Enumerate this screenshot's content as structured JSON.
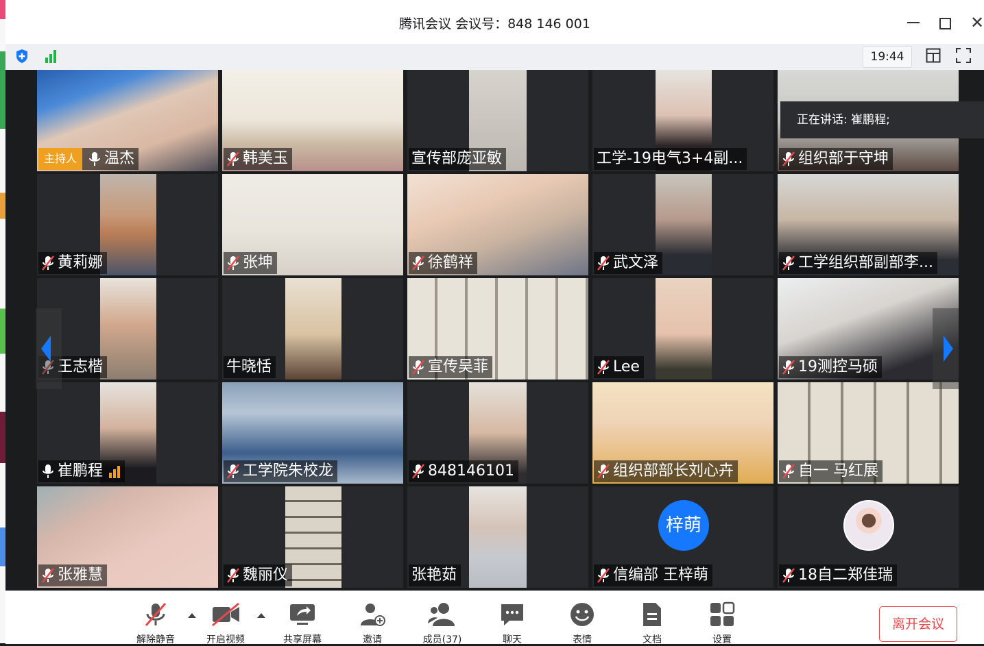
{
  "window": {
    "title": "腾讯会议 会议号：848 146 001"
  },
  "toolbar": {
    "time": "19:44"
  },
  "speaking": {
    "text": "正在讲话: 崔鹏程;"
  },
  "host_badge": "主持人",
  "tiles": [
    {
      "name": "温杰",
      "mic": "on"
    },
    {
      "name": "韩美玉",
      "mic": "muted"
    },
    {
      "name": "宣传部庞亚敏",
      "mic": "none"
    },
    {
      "name": "工学-19电气3+4副...",
      "mic": "none"
    },
    {
      "name": "组织部于守坤",
      "mic": "muted"
    },
    {
      "name": "黄莉娜",
      "mic": "muted"
    },
    {
      "name": "张坤",
      "mic": "muted"
    },
    {
      "name": "徐鹤祥",
      "mic": "muted"
    },
    {
      "name": "武文泽",
      "mic": "muted"
    },
    {
      "name": "工学组织部副部李...",
      "mic": "muted"
    },
    {
      "name": "王志楷",
      "mic": "muted"
    },
    {
      "name": "牛晓恬",
      "mic": "none"
    },
    {
      "name": "宣传吴菲",
      "mic": "muted"
    },
    {
      "name": "Lee",
      "mic": "muted"
    },
    {
      "name": "19测控马硕",
      "mic": "muted"
    },
    {
      "name": "崔鹏程",
      "mic": "on"
    },
    {
      "name": "工学院朱校龙",
      "mic": "muted"
    },
    {
      "name": "848146101",
      "mic": "muted"
    },
    {
      "name": "组织部部长刘心卉",
      "mic": "muted"
    },
    {
      "name": "自一  马红展",
      "mic": "muted"
    },
    {
      "name": "张雅慧",
      "mic": "muted"
    },
    {
      "name": "魏丽仪",
      "mic": "muted"
    },
    {
      "name": "张艳茹",
      "mic": "none"
    },
    {
      "name": "信编部  王梓萌",
      "mic": "muted",
      "avatar": "梓萌"
    },
    {
      "name": "18自二郑佳瑞",
      "mic": "muted"
    }
  ],
  "bottom": {
    "unmute": "解除静音",
    "video": "开启视频",
    "share": "共享屏幕",
    "invite": "邀请",
    "members": "成员(37)",
    "chat": "聊天",
    "emoji": "表情",
    "docs": "文档",
    "settings": "设置",
    "leave": "离开会议"
  },
  "colors": {
    "accent": "#1677ff",
    "leave": "#e8484b",
    "host": "#f0a020",
    "signal": "#1fb34a"
  }
}
